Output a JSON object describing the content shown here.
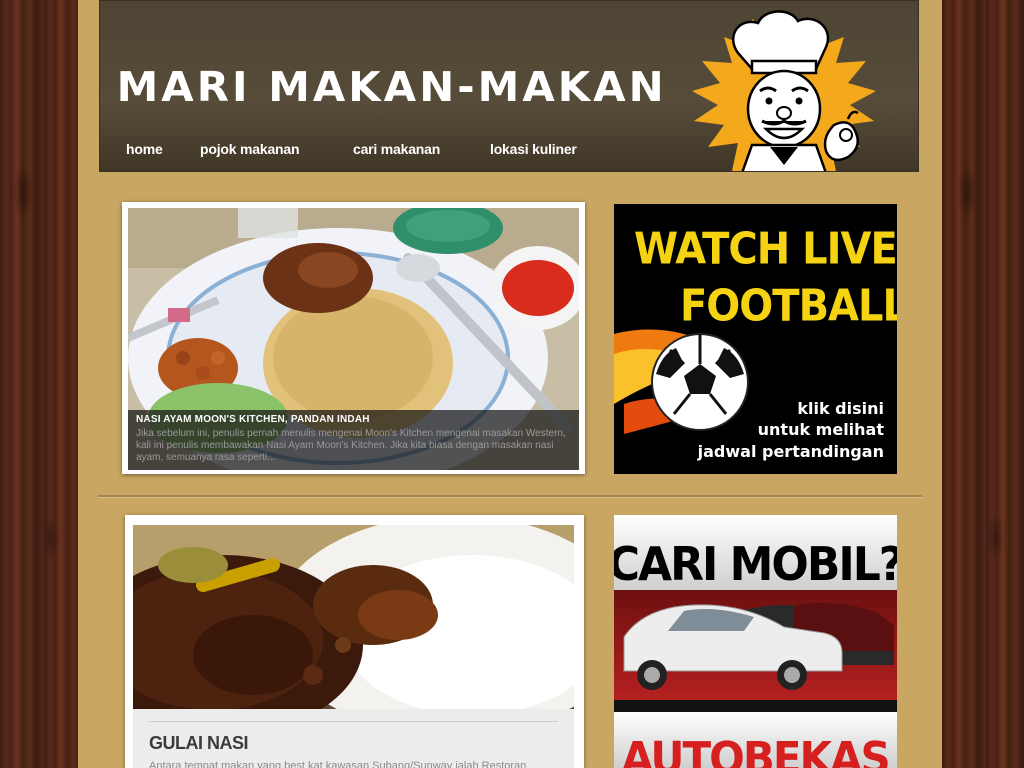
{
  "site": {
    "title": "MARI MAKAN-MAKAN"
  },
  "nav": {
    "items": [
      {
        "label": "home"
      },
      {
        "label": "pojok makanan"
      },
      {
        "label": "cari makanan"
      },
      {
        "label": "lokasi kuliner"
      }
    ]
  },
  "featured": {
    "title": "NASI AYAM MOON'S KITCHEN, PANDAN INDAH",
    "excerpt": "Jika sebelum ini, penulis pernah menulis mengenai Moon's Kitchen mengenai masakan Western, kali ini penulis membawakan Nasi Ayam Moon's Kitchen. Jika kita biasa dengan masakan nasi ayam, semuanya rasa seperti..."
  },
  "ads": {
    "football": {
      "headline_1": "WATCH LIVE",
      "headline_2": "FOOTBALL",
      "cta_1": "klik disini",
      "cta_2": "untuk melihat",
      "cta_3": "jadwal pertandingan"
    },
    "cars": {
      "headline": "CARI MOBIL?",
      "brand": "AUTOBEKAS"
    }
  },
  "post": {
    "title": "GULAI NASI",
    "excerpt": "Antara tempat makan yang best kat kawasan Subang/Sunway ialah Restoran"
  },
  "colors": {
    "page_bg": "#c9a662",
    "header_bg": "#574c39",
    "ad_yellow": "#f5d312",
    "ad_red": "#d61f1f"
  }
}
